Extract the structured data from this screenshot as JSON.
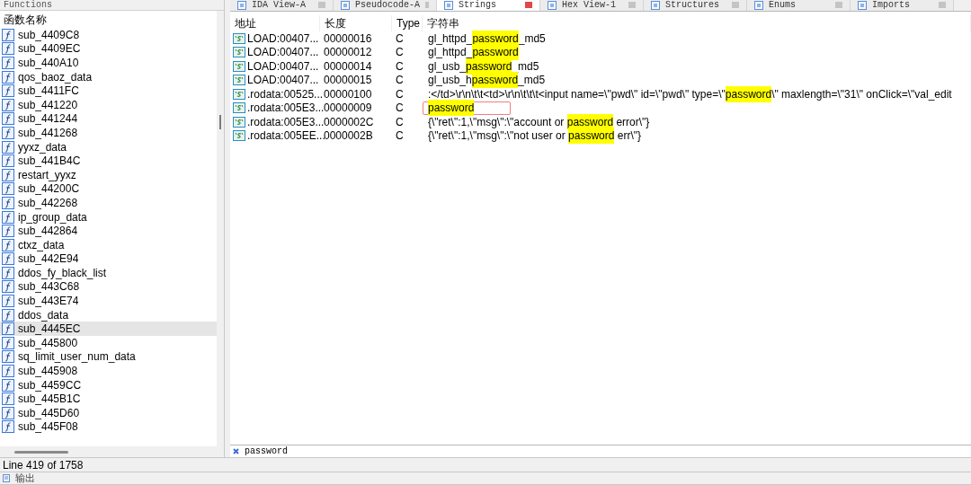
{
  "functions_panel": {
    "title": "Functions",
    "column": "函数名称",
    "items": [
      {
        "name": "sub_4409C8",
        "selected": false
      },
      {
        "name": "sub_4409EC",
        "selected": false
      },
      {
        "name": "sub_440A10",
        "selected": false
      },
      {
        "name": "qos_baoz_data",
        "selected": false
      },
      {
        "name": "sub_4411FC",
        "selected": false
      },
      {
        "name": "sub_441220",
        "selected": false
      },
      {
        "name": "sub_441244",
        "selected": false
      },
      {
        "name": "sub_441268",
        "selected": false
      },
      {
        "name": "yyxz_data",
        "selected": false
      },
      {
        "name": "sub_441B4C",
        "selected": false
      },
      {
        "name": "restart_yyxz",
        "selected": false
      },
      {
        "name": "sub_44200C",
        "selected": false
      },
      {
        "name": "sub_442268",
        "selected": false
      },
      {
        "name": "ip_group_data",
        "selected": false
      },
      {
        "name": "sub_442864",
        "selected": false
      },
      {
        "name": "ctxz_data",
        "selected": false
      },
      {
        "name": "sub_442E94",
        "selected": false
      },
      {
        "name": "ddos_fy_black_list",
        "selected": false
      },
      {
        "name": "sub_443C68",
        "selected": false
      },
      {
        "name": "sub_443E74",
        "selected": false
      },
      {
        "name": "ddos_data",
        "selected": false
      },
      {
        "name": "sub_4445EC",
        "selected": true
      },
      {
        "name": "sub_445800",
        "selected": false
      },
      {
        "name": "sq_limit_user_num_data",
        "selected": false
      },
      {
        "name": "sub_445908",
        "selected": false
      },
      {
        "name": "sub_4459CC",
        "selected": false
      },
      {
        "name": "sub_445B1C",
        "selected": false
      },
      {
        "name": "sub_445D60",
        "selected": false
      },
      {
        "name": "sub_445F08",
        "selected": false
      }
    ]
  },
  "tabs": [
    {
      "label": "IDA View-A",
      "selected": false
    },
    {
      "label": "Pseudocode-A",
      "selected": false
    },
    {
      "label": "Strings",
      "selected": true
    },
    {
      "label": "Hex View-1",
      "selected": false
    },
    {
      "label": "Structures",
      "selected": false
    },
    {
      "label": "Enums",
      "selected": false
    },
    {
      "label": "Imports",
      "selected": false
    }
  ],
  "table": {
    "columns": [
      "地址",
      "长度",
      "Type",
      "字符串"
    ],
    "rows": [
      {
        "address": "LOAD:00407...",
        "length": "00000016",
        "type": "C",
        "selected": false,
        "string": [
          {
            "text": "gl_httpd_",
            "highlight": false
          },
          {
            "text": "password",
            "highlight": true
          },
          {
            "text": "_md5",
            "highlight": false
          }
        ]
      },
      {
        "address": "LOAD:00407...",
        "length": "00000012",
        "type": "C",
        "selected": false,
        "string": [
          {
            "text": "gl_httpd_",
            "highlight": false
          },
          {
            "text": "password",
            "highlight": true
          }
        ]
      },
      {
        "address": "LOAD:00407...",
        "length": "00000014",
        "type": "C",
        "selected": false,
        "string": [
          {
            "text": "gl_usb_",
            "highlight": false
          },
          {
            "text": "password",
            "highlight": true
          },
          {
            "text": "_md5",
            "highlight": false
          }
        ]
      },
      {
        "address": "LOAD:00407...",
        "length": "00000015",
        "type": "C",
        "selected": false,
        "string": [
          {
            "text": "gl_usb_h",
            "highlight": false
          },
          {
            "text": "password",
            "highlight": true
          },
          {
            "text": "_md5",
            "highlight": false
          }
        ]
      },
      {
        "address": ".rodata:00525...",
        "length": "00000100",
        "type": "C",
        "selected": false,
        "string": [
          {
            "text": ":</td>\\r\\n\\t\\t<td>\\r\\n\\t\\t\\t<input name=\\\"pwd\\\" id=\\\"pwd\\\" type=\\\"",
            "highlight": false
          },
          {
            "text": "password",
            "highlight": true
          },
          {
            "text": "\\\" maxlength=\\\"31\\\" onClick=\\\"val_edit",
            "highlight": false
          }
        ]
      },
      {
        "address": ".rodata:005E3...",
        "length": "00000009",
        "type": "C",
        "selected": true,
        "string": [
          {
            "text": "password",
            "highlight": true
          }
        ]
      },
      {
        "address": ".rodata:005E3...",
        "length": "0000002C",
        "type": "C",
        "selected": false,
        "string": [
          {
            "text": "{\\\"ret\\\":1,\\\"msg\\\":\\\"account or ",
            "highlight": false
          },
          {
            "text": "password",
            "highlight": true
          },
          {
            "text": " error\\\"}",
            "highlight": false
          }
        ]
      },
      {
        "address": ".rodata:005EE...",
        "length": "0000002B",
        "type": "C",
        "selected": false,
        "string": [
          {
            "text": "{\\\"ret\\\":1,\\\"msg\\\":\\\"not user or ",
            "highlight": false
          },
          {
            "text": "password",
            "highlight": true
          },
          {
            "text": " err\\\"}",
            "highlight": false
          }
        ]
      }
    ]
  },
  "search": {
    "value": "password"
  },
  "status_bar": "Line 419 of 1758",
  "output_bar": {
    "title": "输出"
  }
}
